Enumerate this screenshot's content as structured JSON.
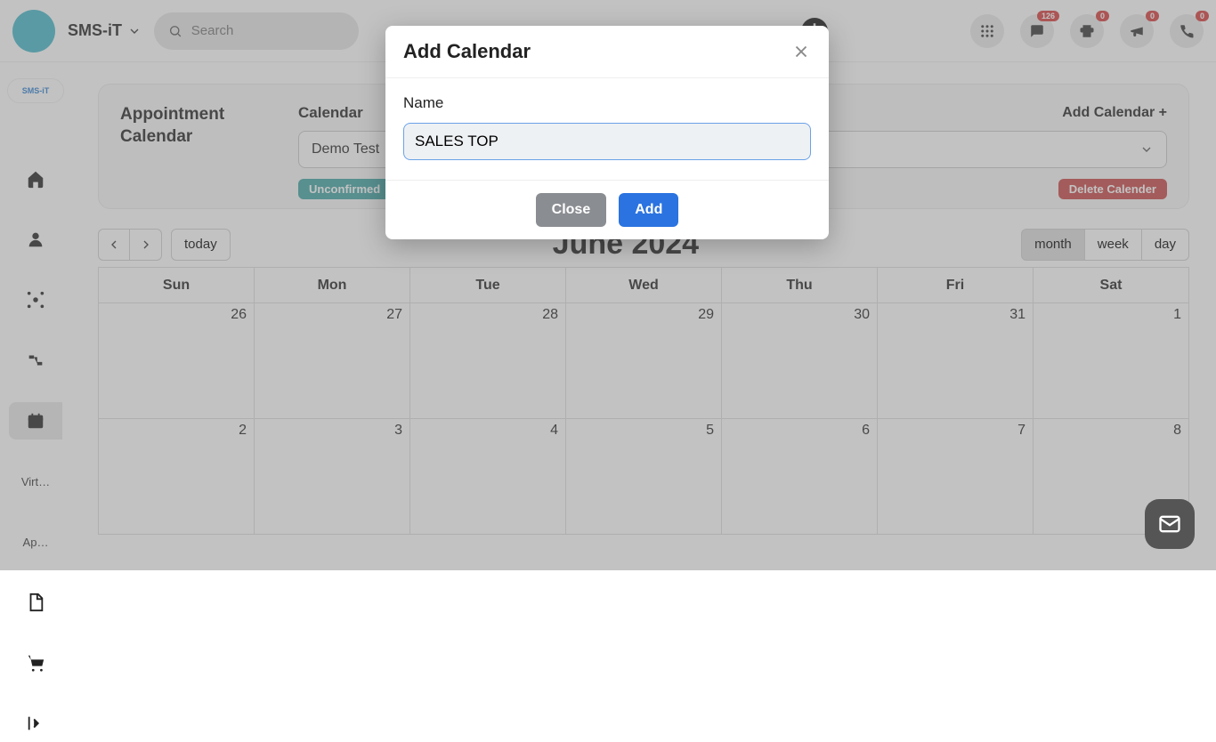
{
  "brand": {
    "name": "SMS-iT",
    "pill_text": "SMS-iT"
  },
  "search": {
    "placeholder": "Search"
  },
  "topbar": {
    "badges": {
      "chat": "126",
      "print": "0",
      "announce": "0",
      "phone": "0"
    }
  },
  "sidebar": {
    "items": [
      {
        "name": "home-icon"
      },
      {
        "name": "user-icon"
      },
      {
        "name": "network-icon"
      },
      {
        "name": "flow-icon"
      },
      {
        "name": "calendar-icon",
        "active": true
      },
      {
        "label": "Virt…"
      },
      {
        "label": "Ap…"
      },
      {
        "name": "doc-icon"
      },
      {
        "name": "cart-icon"
      },
      {
        "name": "collapse-icon"
      }
    ]
  },
  "appointments": {
    "section_title_a": "Appointment",
    "section_title_b": "Calendar",
    "calendar_label": "Calendar",
    "selected_calendar": "Demo Test",
    "add_calendar_link": "Add Calendar +",
    "status_unconfirmed": "Unconfirmed",
    "delete_btn": "Delete Calender"
  },
  "calendar": {
    "today_label": "today",
    "month_title": "June 2024",
    "views": {
      "month": "month",
      "week": "week",
      "day": "day"
    },
    "days": [
      "Sun",
      "Mon",
      "Tue",
      "Wed",
      "Thu",
      "Fri",
      "Sat"
    ],
    "week1": [
      "26",
      "27",
      "28",
      "29",
      "30",
      "31",
      "1"
    ],
    "week2": [
      "2",
      "3",
      "4",
      "5",
      "6",
      "7",
      "8"
    ]
  },
  "modal": {
    "title": "Add Calendar",
    "name_label": "Name",
    "name_value": "SALES TOP",
    "close_label": "Close",
    "add_label": "Add"
  }
}
